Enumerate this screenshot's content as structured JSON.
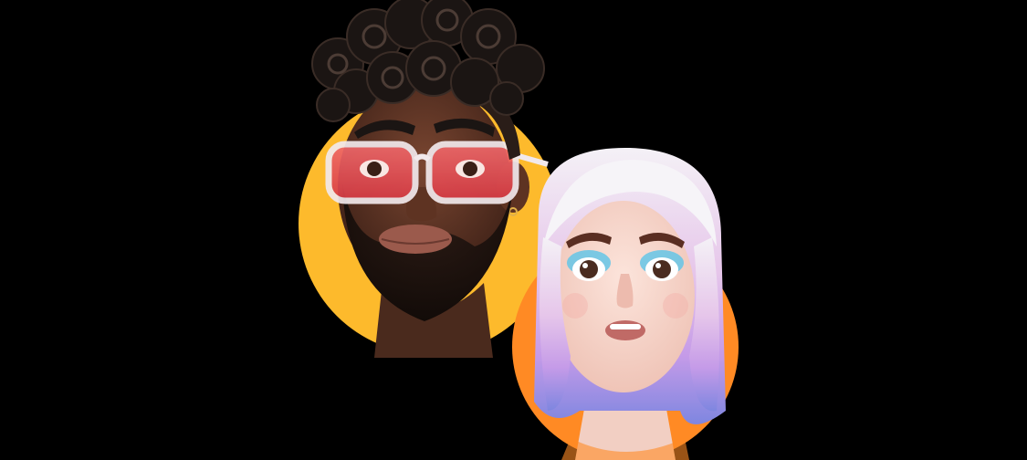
{
  "colors": {
    "background": "#000000",
    "male_circle": "#FDBA2C",
    "female_circle": "#FF8A24",
    "male_skin": "#5A3424",
    "male_hair": "#1B1513",
    "glasses_lens": "#E8484C",
    "glasses_frame": "#F2E9EC",
    "female_skin": "#F7D9CF",
    "female_hair_top": "#F4F1F6",
    "female_hair_bottom": "#8E7FE6",
    "eyeshadow": "#5BC4E8"
  },
  "avatars": [
    {
      "name": "male-memoji",
      "description_icon": "memoji-man-curly-hair-red-glasses"
    },
    {
      "name": "female-memoji",
      "description_icon": "memoji-woman-pastel-hair"
    }
  ]
}
